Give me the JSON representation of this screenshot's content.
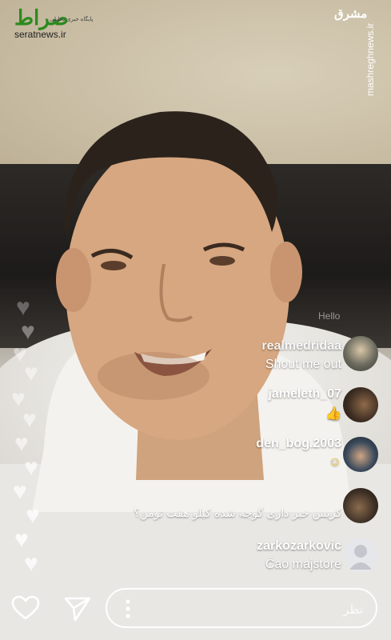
{
  "watermarks": {
    "seratnews_logo": "صراط",
    "seratnews_tagline": "پایگاه خبری تحلیلی",
    "seratnews_url": "seratnews.ir",
    "mashregh_logo": "مشرق",
    "mashregh_url": "mashreghnews.ir"
  },
  "overlay": {
    "ghost_text": "Hello"
  },
  "comments": [
    {
      "user": "realmedridaa",
      "text": "Shout me out"
    },
    {
      "user": "jameleth_07",
      "text": "👍"
    },
    {
      "user": "den_bog.2003",
      "text": "☺"
    },
    {
      "user": "",
      "text": "کریس خبر داری گوجه شده کیلو هفت تومن؟"
    },
    {
      "user": "zarkozarkovic",
      "text": "Ćao majstore"
    }
  ],
  "composer": {
    "placeholder": "نظر"
  },
  "icons": {
    "like": "heart-outline-icon",
    "share": "paper-plane-icon",
    "more": "vertical-dots-icon"
  }
}
